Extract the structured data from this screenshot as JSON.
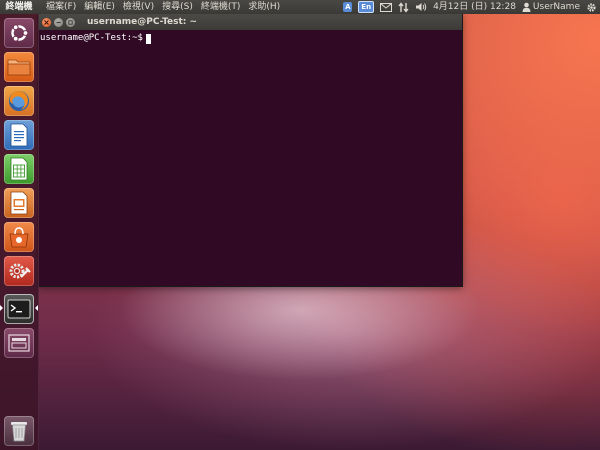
{
  "top_panel": {
    "app_name": "終端機",
    "menu": [
      "檔案(F)",
      "編輯(E)",
      "檢視(V)",
      "搜尋(S)",
      "終端機(T)",
      "求助(H)"
    ],
    "indicators": {
      "keyboard_icon_letter": "A",
      "language": "En",
      "datetime": "4月12日 (日) 12:28",
      "username": "UserName"
    }
  },
  "launcher": {
    "items": [
      {
        "name": "dash-home",
        "icon": "ubuntu-logo-icon"
      },
      {
        "name": "files",
        "icon": "folder-icon"
      },
      {
        "name": "firefox",
        "icon": "firefox-icon"
      },
      {
        "name": "libreoffice-writer",
        "icon": "writer-document-icon"
      },
      {
        "name": "libreoffice-calc",
        "icon": "calc-spreadsheet-icon"
      },
      {
        "name": "libreoffice-impress",
        "icon": "impress-presentation-icon"
      },
      {
        "name": "ubuntu-software-center",
        "icon": "software-center-bag-icon"
      },
      {
        "name": "system-settings",
        "icon": "settings-gear-wrench-icon"
      },
      {
        "name": "terminal",
        "icon": "terminal-icon",
        "active": true
      },
      {
        "name": "workspace-switcher",
        "icon": "workspace-icon"
      },
      {
        "name": "trash",
        "icon": "trash-icon"
      }
    ]
  },
  "terminal": {
    "title": "username@PC-Test: ~",
    "prompt": "username@PC-Test:~$"
  },
  "colors": {
    "terminal_background": "#300a24",
    "panel_background": "#3c3b37",
    "close_button": "#e0571e"
  }
}
